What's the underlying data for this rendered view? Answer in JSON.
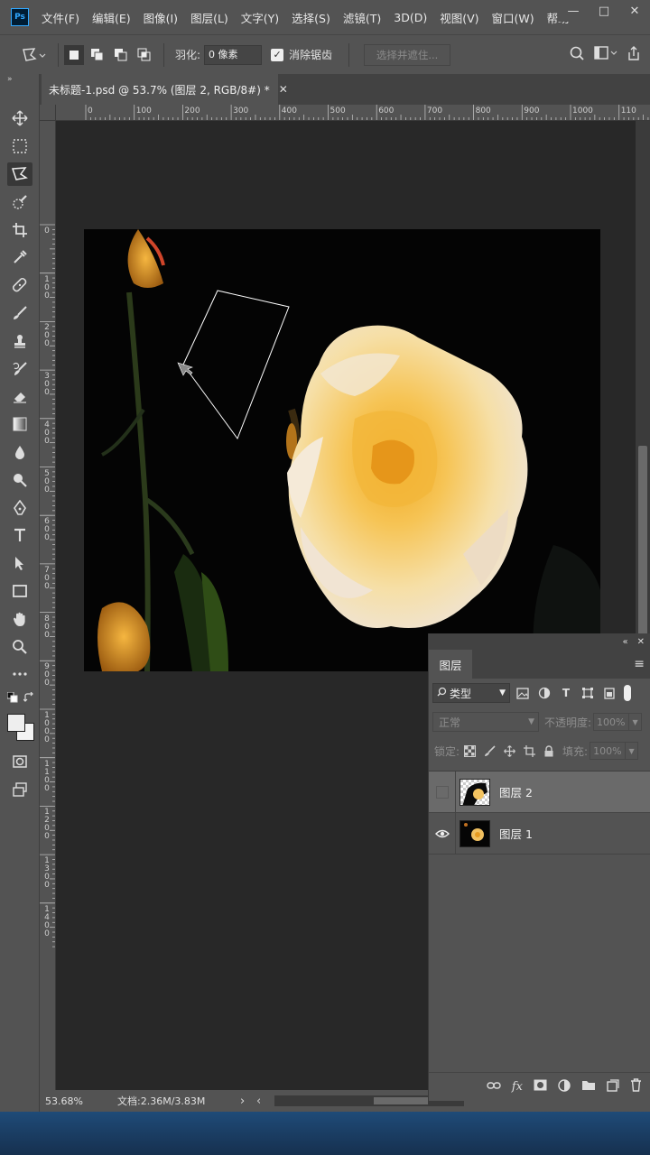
{
  "app": {
    "logo": "Ps",
    "menus": [
      "文件(F)",
      "编辑(E)",
      "图像(I)",
      "图层(L)",
      "文字(Y)",
      "选择(S)",
      "滤镜(T)",
      "3D(D)",
      "视图(V)",
      "窗口(W)",
      "帮助"
    ]
  },
  "options_bar": {
    "feather_label": "羽化:",
    "feather_value": "0 像素",
    "antialias_label": "消除锯齿",
    "antialias_checked": true,
    "select_mask_label": "选择并遮住..."
  },
  "document": {
    "tab_title": "未标题-1.psd @ 53.7% (图层 2, RGB/8#) *"
  },
  "rulers": {
    "top": [
      "0",
      "100",
      "200",
      "300",
      "400",
      "500",
      "600",
      "700",
      "800",
      "900",
      "1000",
      "110"
    ],
    "left": [
      "0",
      "100",
      "200",
      "300",
      "400",
      "500",
      "600",
      "700",
      "800",
      "900",
      "1000",
      "1100",
      "1200",
      "1300",
      "1400"
    ]
  },
  "status": {
    "zoom": "53.68%",
    "doc_size": "文档:2.36M/3.83M"
  },
  "layers_panel": {
    "tab_label": "图层",
    "filter_label": "类型",
    "blend_mode": "正常",
    "opacity_label": "不透明度:",
    "opacity_value": "100%",
    "lock_label": "锁定:",
    "fill_label": "填充:",
    "fill_value": "100%",
    "layers": [
      {
        "name": "图层 2",
        "visible": false,
        "selected": true
      },
      {
        "name": "图层 1",
        "visible": true,
        "selected": false
      }
    ]
  },
  "colors": {
    "panel_bg": "#535353",
    "canvas_bg": "#282828",
    "accent": "#31a8ff",
    "rose": "#f2c45e"
  },
  "tools": [
    "move-tool",
    "marquee-tool",
    "polygonal-lasso-tool",
    "quick-selection-tool",
    "crop-tool",
    "eyedropper-tool",
    "healing-brush-tool",
    "brush-tool",
    "clone-stamp-tool",
    "history-brush-tool",
    "eraser-tool",
    "gradient-tool",
    "blur-tool",
    "dodge-tool",
    "pen-tool",
    "type-tool",
    "path-selection-tool",
    "rectangle-tool",
    "hand-tool",
    "zoom-tool",
    "more-tools"
  ]
}
